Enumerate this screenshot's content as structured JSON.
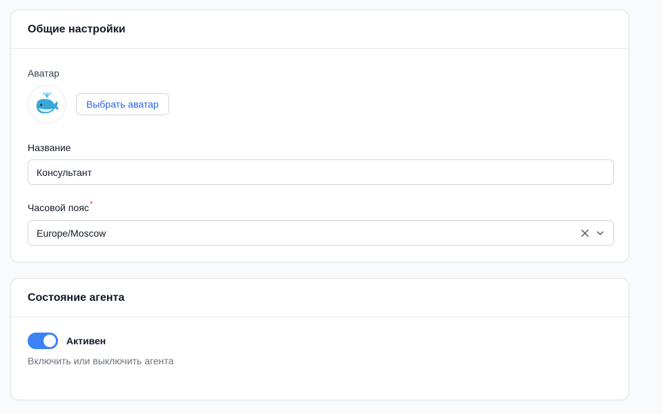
{
  "general": {
    "title": "Общие настройки",
    "avatar_label": "Аватар",
    "avatar_icon": "whale-emoji",
    "choose_avatar_label": "Выбрать аватар",
    "name_label": "Название",
    "name_value": "Консультант",
    "timezone_label": "Часовой пояс",
    "timezone_required_mark": "*",
    "timezone_value": "Europe/Moscow",
    "clear_icon": "close-icon",
    "dropdown_icon": "chevron-down-icon"
  },
  "agent_state": {
    "title": "Состояние агента",
    "toggle_on": true,
    "toggle_label": "Активен",
    "help_text": "Включить или выключить агента"
  },
  "colors": {
    "accent": "#3b82f6",
    "link": "#2563eb",
    "required": "#ef4444",
    "border": "#e5e7eb"
  }
}
